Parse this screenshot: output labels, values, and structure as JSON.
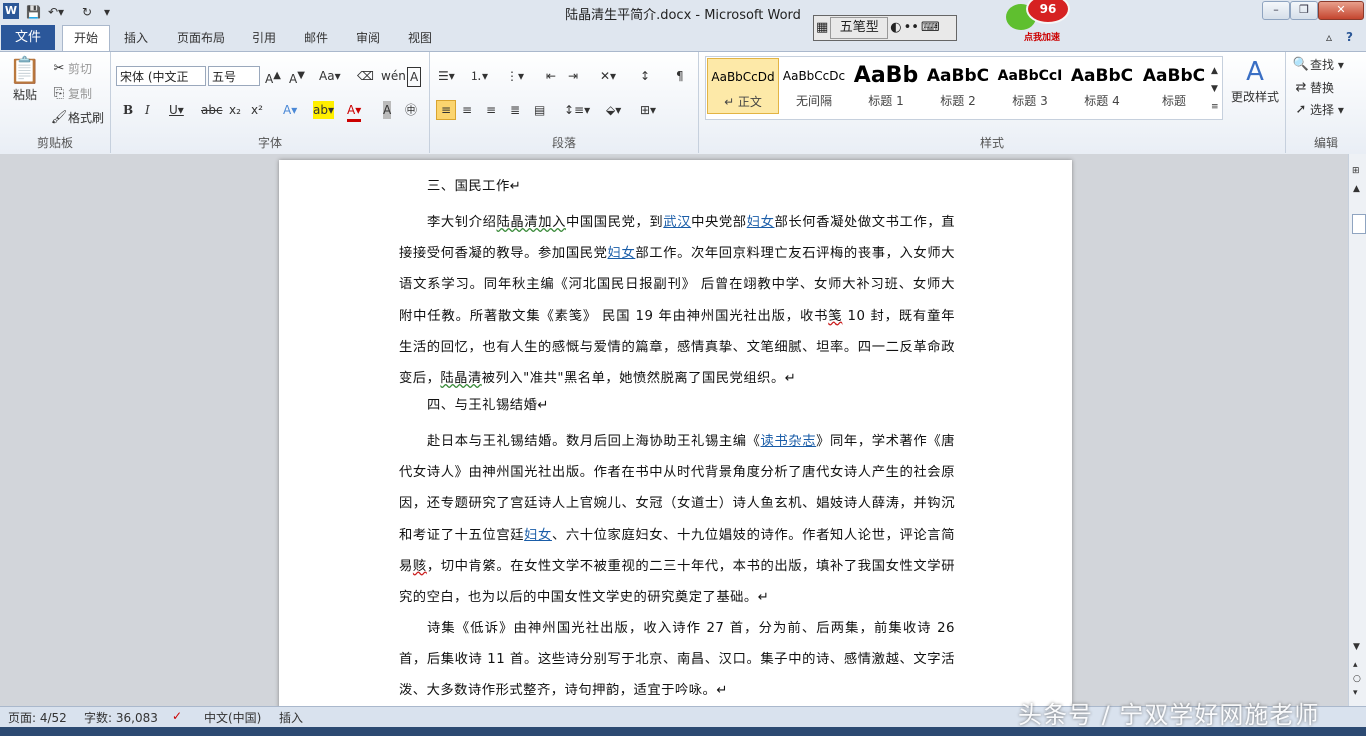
{
  "window": {
    "title": "陆晶清生平简介.docx - Microsoft Word",
    "app_icon": "W",
    "controls": [
      "–",
      "❐",
      "✕"
    ]
  },
  "ime_bar": {
    "label": "五笔型",
    "icons": [
      "moon-icon",
      "dots-icon",
      "keyboard-icon"
    ]
  },
  "speed_ball": {
    "value": "96",
    "label": "点我加速"
  },
  "tabs": {
    "file": "文件",
    "items": [
      "开始",
      "插入",
      "页面布局",
      "引用",
      "邮件",
      "审阅",
      "视图"
    ],
    "active": "开始"
  },
  "ribbon": {
    "clipboard": {
      "paste": "粘贴",
      "cut": "剪切",
      "copy": "复制",
      "format_painter": "格式刷",
      "label": "剪贴板"
    },
    "font": {
      "font_name": "宋体 (中文正",
      "font_size": "五号",
      "label": "字体"
    },
    "paragraph": {
      "label": "段落"
    },
    "styles": {
      "label": "样式",
      "items": [
        {
          "sample": "AaBbCcDd",
          "name": "↵ 正文"
        },
        {
          "sample": "AaBbCcDc",
          "name": "无间隔"
        },
        {
          "sample": "AaBb",
          "name": "标题 1"
        },
        {
          "sample": "AaBbC",
          "name": "标题 2"
        },
        {
          "sample": "AaBbCcI",
          "name": "标题 3"
        },
        {
          "sample": "AaBbC",
          "name": "标题 4"
        },
        {
          "sample": "AaBbC",
          "name": "标题"
        }
      ],
      "change_styles": "更改样式"
    },
    "editing": {
      "find": "查找",
      "replace": "替换",
      "select": "选择",
      "label": "编辑"
    }
  },
  "document": {
    "h3": "三、国民工作↵",
    "p1_a": "李大钊介绍",
    "p1_b": "陆晶清加入",
    "p1_c": "中国国民党，到",
    "p1_link1": "武汉",
    "p1_d": "中央党部",
    "p1_link2": "妇女",
    "p1_e": "部长何香凝处做文书工作，直接接受何香凝的教导。参加国民党",
    "p1_link3": "妇女",
    "p1_f": "部工作。次年回京料理亡友石评梅的丧事，入女师大语文系学习。同年秋主编《河北国民日报副刊》 后曾在翊教中学、女师大补习班、女师大附中任教。所著散文集《素笺》 民国 19 年由神州国光社出版，收书",
    "p1_g": "笺",
    "p1_h": " 10 封，既有童年生活的回忆，也有人生的感慨与爱情的篇章，感情真挚、文笔细腻、坦率。四一二反革命政变后，",
    "p1_i": "陆晶清",
    "p1_j": "被列入\"准共\"黑名单，她愤然脱离了国民党组织。↵",
    "h4": "四、与王礼锡结婚↵",
    "p2_a": "赴日本与王礼锡结婚。数月后回上海协助王礼锡主编《",
    "p2_link1": "读书杂志",
    "p2_b": "》同年，学术著作《唐代女诗人》由神州国光社出版。作者在书中从时代背景角度分析了唐代女诗人产生的社会原因，还专题研究了宫廷诗人上官婉儿、女冠（女道士）诗人鱼玄机、娼妓诗人薛涛，并钩沉和考证了十五位宫廷",
    "p2_link2": "妇女",
    "p2_c": "、六十位家庭妇女、十九位娼妓的诗作。作者知人论世，评论言简易",
    "p2_d": "赅",
    "p2_e": "，切中肯綮。在女性文学不被重视的二三十年代，本书的出版，填补了我国女性文学研究的空白，也为以后的中国女性文学史的研究奠定了基础。↵",
    "p3": "诗集《低诉》由神州国光社出版，收入诗作 27 首，分为前、后两集，前集收诗 26 首，后集收诗 11 首。这些诗分别写于北京、南昌、汉口。集子中的诗、感情激越、文字活泼、大多数诗作形式整齐，诗句押韵，适宜于吟咏。↵"
  },
  "status_bar": {
    "page": "页面: 4/52",
    "words": "字数: 36,083",
    "lang": "中文(中国)",
    "mode": "插入"
  },
  "watermark": "头条号 / 宁双学好网施老师"
}
